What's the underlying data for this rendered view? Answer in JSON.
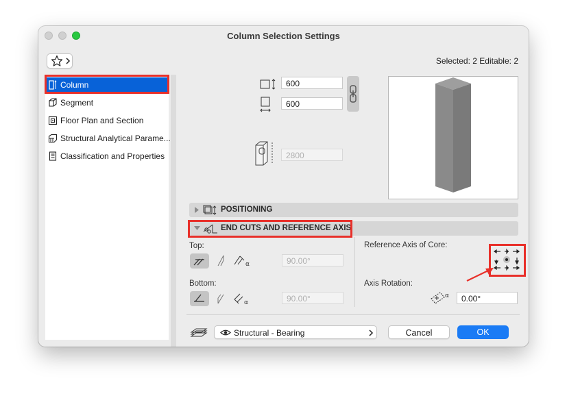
{
  "window": {
    "title": "Column Selection Settings"
  },
  "header": {
    "selected_info": "Selected: 2 Editable: 2"
  },
  "sidebar": {
    "items": [
      {
        "label": "Column",
        "icon": "column-icon",
        "active": true
      },
      {
        "label": "Segment",
        "icon": "segment-icon"
      },
      {
        "label": "Floor Plan and Section",
        "icon": "floor-plan-icon"
      },
      {
        "label": "Structural Analytical Parame...",
        "icon": "structural-analytical-icon"
      },
      {
        "label": "Classification and Properties",
        "icon": "classification-icon"
      }
    ]
  },
  "dimensions": {
    "width_value": "600",
    "depth_value": "600",
    "height_value": "2800"
  },
  "sections": {
    "positioning": "POSITIONING",
    "end_cuts": "END CUTS AND REFERENCE AXIS"
  },
  "end_cuts": {
    "top_label": "Top:",
    "top_angle": "90.00°",
    "bottom_label": "Bottom:",
    "bottom_angle": "90.00°",
    "ref_axis_label": "Reference Axis of Core:",
    "axis_rotation_label": "Axis Rotation:",
    "axis_rotation_value": "0.00°"
  },
  "footer": {
    "structural_function": "Structural - Bearing",
    "cancel": "Cancel",
    "ok": "OK"
  },
  "colors": {
    "accent": "#0862d8",
    "ok_button": "#1a7bf5",
    "highlight": "#e8302a"
  }
}
